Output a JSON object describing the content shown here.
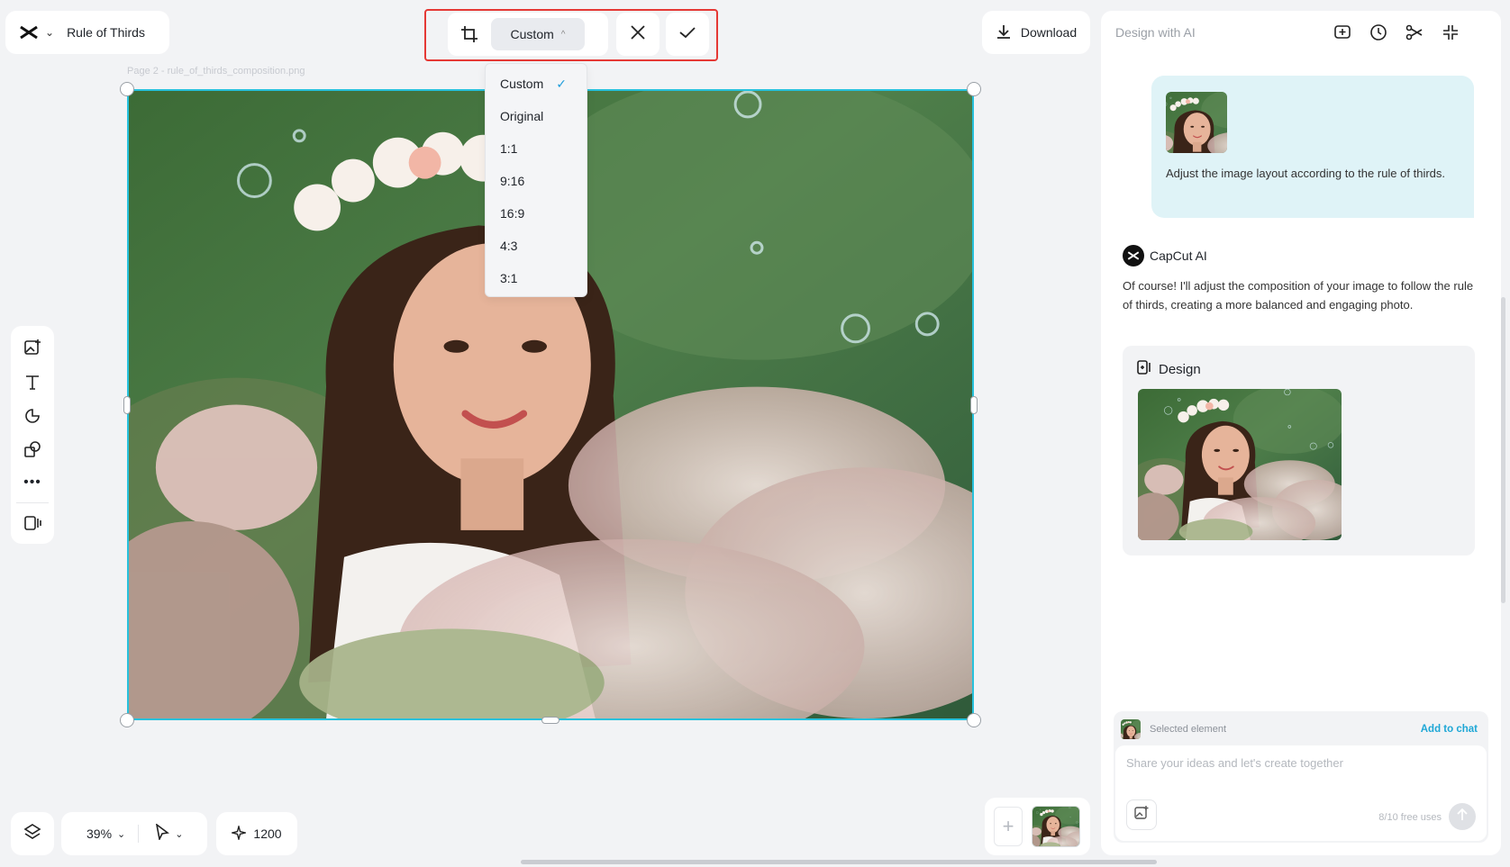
{
  "project": {
    "title": "Rule of Thirds"
  },
  "crop_toolbar": {
    "ratio_label": "Custom",
    "ratio_options": [
      "Custom",
      "Original",
      "1:1",
      "9:16",
      "16:9",
      "4:3",
      "3:1"
    ],
    "selected_option": "Custom"
  },
  "canvas": {
    "page_label": "Page 2  -   rule_of_thirds_composition.png"
  },
  "download": {
    "label": "Download"
  },
  "bottom_bar": {
    "zoom": "39%",
    "credits": "1200"
  },
  "panel": {
    "title": "Design with AI",
    "user_message": "Adjust the image layout according to the rule of thirds.",
    "ai_name": "CapCut AI",
    "ai_reply": "Of course! I'll adjust the composition of your image to follow the rule of thirds, creating a more balanced and engaging photo.",
    "design_card_title": "Design",
    "selected_element_label": "Selected element",
    "add_to_chat": "Add to chat",
    "chat_placeholder": "Share your ideas and let's create together",
    "free_uses": "8/10 free uses"
  },
  "colors": {
    "accent": "#27c1dc",
    "highlight_border": "#e53935",
    "check": "#1e9ddb",
    "link": "#1ea7d6"
  },
  "icons": [
    "capcut-logo-icon",
    "crop-icon",
    "close-icon",
    "check-icon",
    "download-icon",
    "image-add-icon",
    "text-icon",
    "sticker-icon",
    "shapes-icon",
    "more-icon",
    "present-icon",
    "layers-icon",
    "pointer-icon",
    "sparkle-icon",
    "new-chat-icon",
    "history-icon",
    "share-icon",
    "collapse-icon",
    "attach-image-icon",
    "send-icon"
  ]
}
